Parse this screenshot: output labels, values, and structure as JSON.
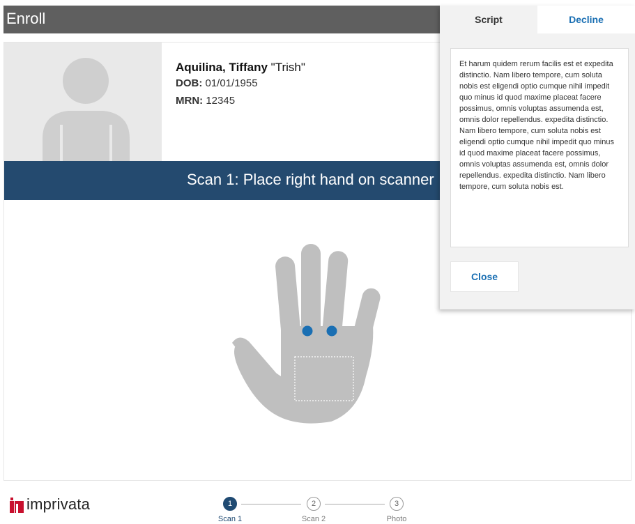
{
  "header": {
    "title": "Enroll"
  },
  "patient": {
    "name": "Aquilina, Tiffany",
    "nickname": "\"Trish\"",
    "dob_label": "DOB:",
    "dob": "01/01/1955",
    "mrn_label": "MRN:",
    "mrn": "12345"
  },
  "banner": {
    "text": "Scan 1: Place right hand on scanner"
  },
  "steps": [
    {
      "number": "1",
      "label": "Scan 1",
      "active": true
    },
    {
      "number": "2",
      "label": "Scan 2",
      "active": false
    },
    {
      "number": "3",
      "label": "Photo",
      "active": false
    }
  ],
  "logo": {
    "text": "imprivata"
  },
  "panel": {
    "tabs": {
      "script": "Script",
      "decline": "Decline"
    },
    "script_text": "Et harum quidem rerum facilis est et expedita distinctio. Nam libero tempore, cum soluta nobis est eligendi optio cumque nihil impedit quo minus id quod maxime placeat facere possimus, omnis voluptas assumenda est, omnis dolor repellendus. expedita distinctio. Nam libero tempore, cum soluta nobis est eligendi optio cumque nihil impedit quo minus id quod maxime placeat facere possimus, omnis voluptas assumenda est, omnis dolor repellendus. expedita distinctio. Nam libero tempore, cum soluta nobis est.",
    "close_label": "Close"
  },
  "colors": {
    "header_bg": "#5f5f5f",
    "banner_bg": "#244a6f",
    "accent": "#1a6fb3",
    "hand_gray": "#bfbfbf",
    "logo_red": "#c8102e"
  },
  "icons": {
    "avatar": "person-silhouette-icon",
    "hand": "hand-scan-icon",
    "logo": "imprivata-logo-icon"
  }
}
